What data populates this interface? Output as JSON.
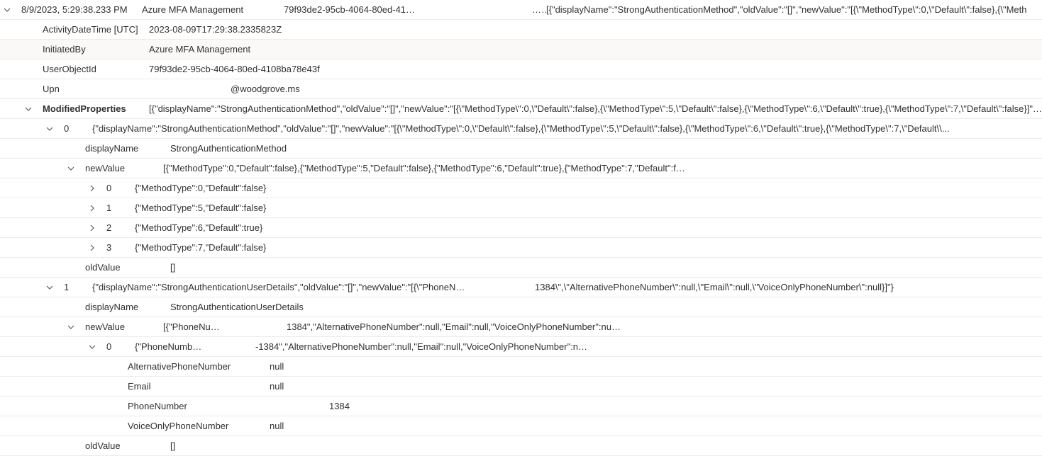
{
  "summary": {
    "timestamp": "8/9/2023, 5:29:38.233 PM",
    "app": "Azure MFA Management",
    "guid": "79f93de2-95cb-4064-80ed-41…",
    "mid": "…",
    "json_preview": "[{\"displayName\":\"StrongAuthenticationMethod\",\"oldValue\":\"[]\",\"newValue\":\"[{\\\"MethodType\\\":0,\\\"Default\\\":false},{\\\"Meth"
  },
  "details": {
    "activity_label": "ActivityDateTime [UTC]",
    "activity_val": "2023-08-09T17:29:38.2335823Z",
    "initiated_label": "InitiatedBy",
    "initiated_val": "Azure MFA Management",
    "userobj_label": "UserObjectId",
    "userobj_val": "79f93de2-95cb-4064-80ed-4108ba78e43f",
    "upn_label": "Upn",
    "upn_val": "@woodgrove.ms"
  },
  "modprops": {
    "label": "ModifiedProperties",
    "preview": "[{\"displayName\":\"StrongAuthenticationMethod\",\"oldValue\":\"[]\",\"newValue\":\"[{\\\"MethodType\\\":0,\\\"Default\\\":false},{\\\"MethodType\\\":5,\\\"Default\\\":false},{\\\"MethodType\\\":6,\\\"Default\\\":true},{\\\"MethodType\\\":7,\\\"Default\\\":false}]\"},{\"d"
  },
  "item0": {
    "idx": "0",
    "preview": "{\"displayName\":\"StrongAuthenticationMethod\",\"oldValue\":\"[]\",\"newValue\":\"[{\\\"MethodType\\\":0,\\\"Default\\\":false},{\\\"MethodType\\\":5,\\\"Default\\\":false},{\\\"MethodType\\\":6,\\\"Default\\\":true},{\\\"MethodType\\\":7,\\\"Default\\\\...",
    "displayName_label": "displayName",
    "displayName_val": "StrongAuthenticationMethod",
    "newValue_label": "newValue",
    "newValue_preview": "[{\"MethodType\":0,\"Default\":false},{\"MethodType\":5,\"Default\":false},{\"MethodType\":6,\"Default\":true},{\"MethodType\":7,\"Default\":f…",
    "nv0_idx": "0",
    "nv0_val": "{\"MethodType\":0,\"Default\":false}",
    "nv1_idx": "1",
    "nv1_val": "{\"MethodType\":5,\"Default\":false}",
    "nv2_idx": "2",
    "nv2_val": "{\"MethodType\":6,\"Default\":true}",
    "nv3_idx": "3",
    "nv3_val": "{\"MethodType\":7,\"Default\":false}",
    "oldValue_label": "oldValue",
    "oldValue_val": "[]"
  },
  "item1": {
    "idx": "1",
    "preview_a": "{\"displayName\":\"StrongAuthenticationUserDetails\",\"oldValue\":\"[]\",\"newValue\":\"[{\\\"PhoneNumbe",
    "preview_b": "1384\\\",\\\"AlternativePhoneNumber\\\":null,\\\"Email\\\":null,\\\"VoiceOnlyPhoneNumber\\\":null}]\"}",
    "displayName_label": "displayName",
    "displayName_val": "StrongAuthenticationUserDetails",
    "newValue_label": "newValue",
    "newValue_preview_a": "[{\"PhoneNumber\"",
    "newValue_preview_b": "1384\",\"AlternativePhoneNumber\":null,\"Email\":null,\"VoiceOnlyPhoneNumber\":nu…",
    "nv0_idx": "0",
    "nv0_preview_a": "{\"PhoneNumber\":\"",
    "nv0_preview_b": "-1384\",\"AlternativePhoneNumber\":null,\"Email\":null,\"VoiceOnlyPhoneNumber\":n…",
    "f_alt_label": "AlternativePhoneNumber",
    "f_alt_val": "null",
    "f_email_label": "Email",
    "f_email_val": "null",
    "f_phone_label": "PhoneNumber",
    "f_phone_val": "1384",
    "f_voice_label": "VoiceOnlyPhoneNumber",
    "f_voice_val": "null",
    "oldValue_label": "oldValue",
    "oldValue_val": "[]"
  }
}
